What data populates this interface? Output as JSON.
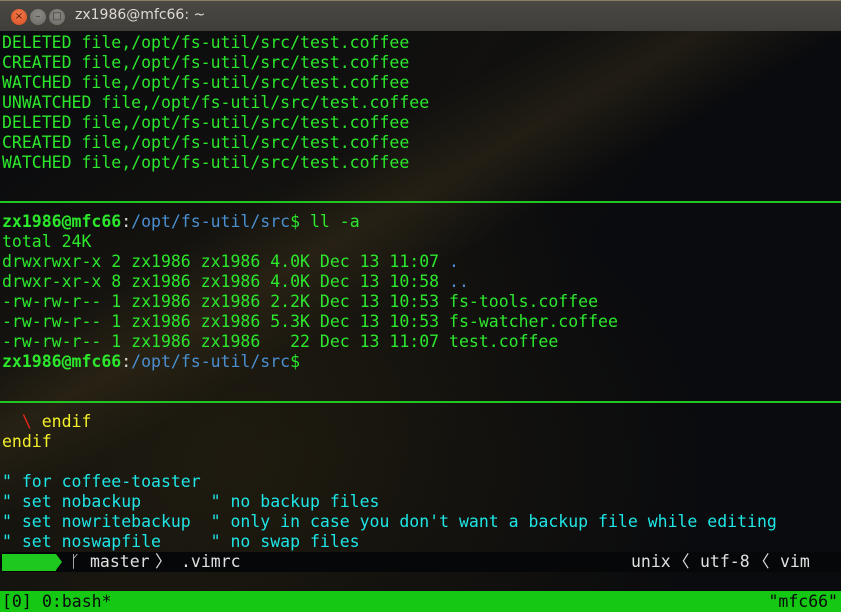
{
  "window": {
    "title": "zx1986@mfc66: ~",
    "controls": {
      "close": "×",
      "minimize": "–",
      "maximize": "□"
    }
  },
  "colors": {
    "output_green": "#2ce82c",
    "path_blue": "#4a8fd0",
    "vim_yellow": "#f4f02a",
    "vim_red": "#e8261a",
    "vim_comment_cyan": "#1ee6e6",
    "divider_green": "#1ec81e",
    "tmux_bar_green": "#14c814"
  },
  "pane_top": {
    "lines": [
      "DELETED file,/opt/fs-util/src/test.coffee",
      "CREATED file,/opt/fs-util/src/test.coffee",
      "WATCHED file,/opt/fs-util/src/test.coffee",
      "UNWATCHED file,/opt/fs-util/src/test.coffee",
      "DELETED file,/opt/fs-util/src/test.coffee",
      "CREATED file,/opt/fs-util/src/test.coffee",
      "WATCHED file,/opt/fs-util/src/test.coffee"
    ]
  },
  "pane_middle": {
    "prompt": {
      "user_host": "zx1986@mfc66",
      "separator": ":",
      "path": "/opt/fs-util/src",
      "symbol": "$"
    },
    "command": " ll -a",
    "total": "total 24K",
    "listing": [
      {
        "meta": "drwxrwxr-x 2 zx1986 zx1986 4.0K Dec 13 11:07 ",
        "name": ".",
        "is_dir": true
      },
      {
        "meta": "drwxr-xr-x 8 zx1986 zx1986 4.0K Dec 13 10:58 ",
        "name": "..",
        "is_dir": true
      },
      {
        "meta": "-rw-rw-r-- 1 zx1986 zx1986 2.2K Dec 13 10:53 ",
        "name": "fs-tools.coffee",
        "is_dir": false
      },
      {
        "meta": "-rw-rw-r-- 1 zx1986 zx1986 5.3K Dec 13 10:53 ",
        "name": "fs-watcher.coffee",
        "is_dir": false
      },
      {
        "meta": "-rw-rw-r-- 1 zx1986 zx1986   22 Dec 13 11:07 ",
        "name": "test.coffee",
        "is_dir": false
      }
    ]
  },
  "pane_vim": {
    "line1": {
      "indent": "  ",
      "backslash": "\\",
      "text": " endif"
    },
    "line2": "endif",
    "comments": [
      "\" for coffee-toaster",
      "\" set nobackup       \" no backup files",
      "\" set nowritebackup  \" only in case you don't want a backup file while editing",
      "\" set noswapfile     \" no swap files"
    ],
    "statusline": {
      "branch_icon": "ᚴ",
      "branch": "master",
      "sep_right": "〉",
      "filename": ".vimrc",
      "fileformat": "unix",
      "sep_left": "〈",
      "encoding": "utf-8",
      "filetype": "vim"
    }
  },
  "tmux": {
    "session": "[0]",
    "window": "0:bash*",
    "host": "\"mfc66\""
  }
}
